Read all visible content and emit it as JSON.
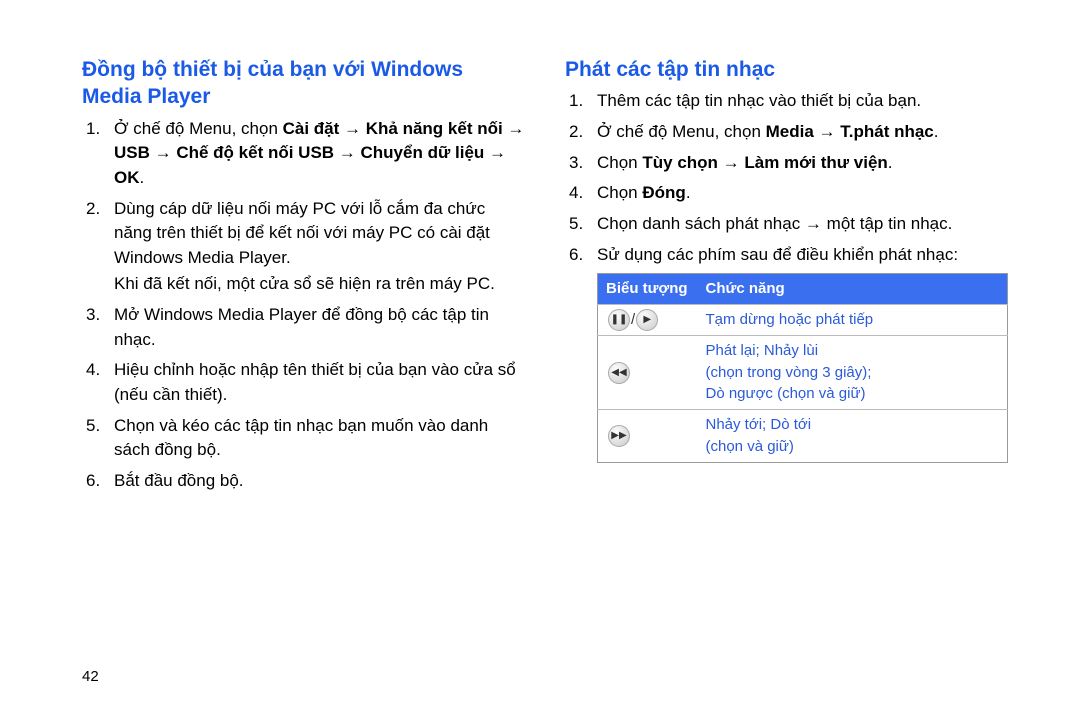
{
  "page_number": "42",
  "left": {
    "heading": "Đồng bộ thiết bị của bạn với Windows Media Player",
    "items": [
      "Ở chế độ Menu, chọn <b>Cài đặt → Khả năng kết nối → USB → Chế độ kết nối USB → Chuyển dữ liệu → OK</b>.",
      "Dùng cáp dữ liệu nối máy PC với lỗ cắm đa chức năng trên thiết bị để kết nối với máy PC có cài đặt Windows Media Player.<span class=\"sub\">Khi đã kết nối, một cửa sổ sẽ hiện ra trên máy PC.</span>",
      "Mở Windows Media Player để đồng bộ các tập tin nhạc.",
      "Hiệu chỉnh hoặc nhập tên thiết bị của bạn vào cửa sổ (nếu cần thiết).",
      "Chọn và kéo các tập tin nhạc bạn muốn vào danh sách đồng bộ.",
      "Bắt đầu đồng bộ."
    ]
  },
  "right": {
    "heading": "Phát các tập tin nhạc",
    "items": [
      "Thêm các tập tin nhạc vào thiết bị của bạn.",
      "Ở chế độ Menu, chọn <b>Media → T.phát nhạc</b>.",
      "Chọn <b>Tùy chọn → Làm mới thư viện</b>.",
      "Chọn <b>Đóng</b>.",
      "Chọn danh sách phát nhạc → một tập tin nhạc.",
      "Sử dụng các phím sau để điều khiển phát nhạc:"
    ],
    "table": {
      "head": {
        "col1": "Biểu tượng",
        "col2": "Chức năng"
      },
      "rows": [
        {
          "icon": "play-pause",
          "text": "Tạm dừng hoặc phát tiếp"
        },
        {
          "icon": "prev",
          "text": "Phát lại; Nhảy lùi<br>(chọn trong vòng 3 giây);<br>Dò ngược (chọn và giữ)"
        },
        {
          "icon": "next",
          "text": "Nhảy tới; Dò tới<br>(chọn và giữ)"
        }
      ]
    }
  }
}
